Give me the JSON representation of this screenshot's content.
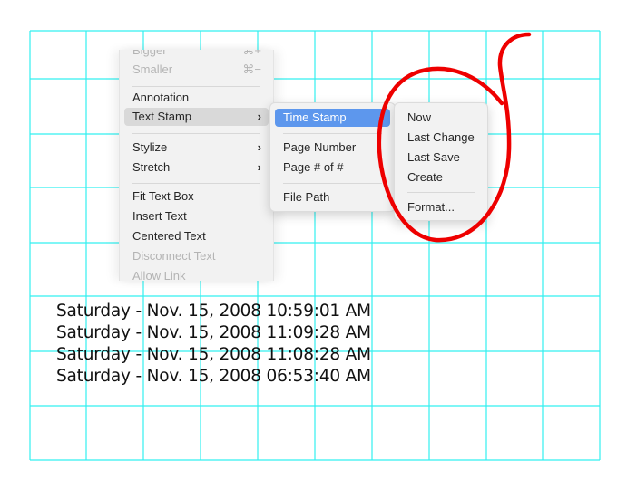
{
  "colors": {
    "grid": "#33f0f0",
    "highlight_blue": "#5d97ed",
    "highlight_gray": "#d9d9d9",
    "annotation_red": "#ee0000",
    "menu_bg": "#f2f2f2"
  },
  "main_menu": {
    "items": [
      {
        "label": "Bigger",
        "shortcut": "⌘+",
        "disabled": true
      },
      {
        "label": "Smaller",
        "shortcut": "⌘−",
        "disabled": true
      },
      {
        "label": "Annotation"
      },
      {
        "label": "Text Stamp",
        "submenu": "›",
        "highlighted": true
      },
      {
        "label": "Stylize",
        "submenu": "›"
      },
      {
        "label": "Stretch",
        "submenu": "›"
      },
      {
        "label": "Fit Text Box"
      },
      {
        "label": "Insert Text"
      },
      {
        "label": "Centered Text"
      },
      {
        "label": "Disconnect Text",
        "disabled": true
      },
      {
        "label": "Allow Link",
        "disabled": true
      }
    ]
  },
  "text_stamp_submenu": {
    "items": [
      {
        "label": "Time Stamp",
        "submenu": "›",
        "highlighted": true
      },
      {
        "label": "Page Number"
      },
      {
        "label": "Page # of #"
      },
      {
        "label": "File Path"
      }
    ]
  },
  "time_stamp_submenu": {
    "items": [
      {
        "label": "Now"
      },
      {
        "label": "Last Change"
      },
      {
        "label": "Last Save"
      },
      {
        "label": "Create"
      },
      {
        "label": "Format..."
      }
    ]
  },
  "document": {
    "stamps": [
      "Saturday - Nov. 15, 2008 10:59:01 AM",
      "Saturday - Nov. 15, 2008 11:09:28 AM",
      "Saturday - Nov. 15, 2008 11:08:28 AM",
      "Saturday - Nov. 15, 2008 06:53:40 AM"
    ]
  }
}
